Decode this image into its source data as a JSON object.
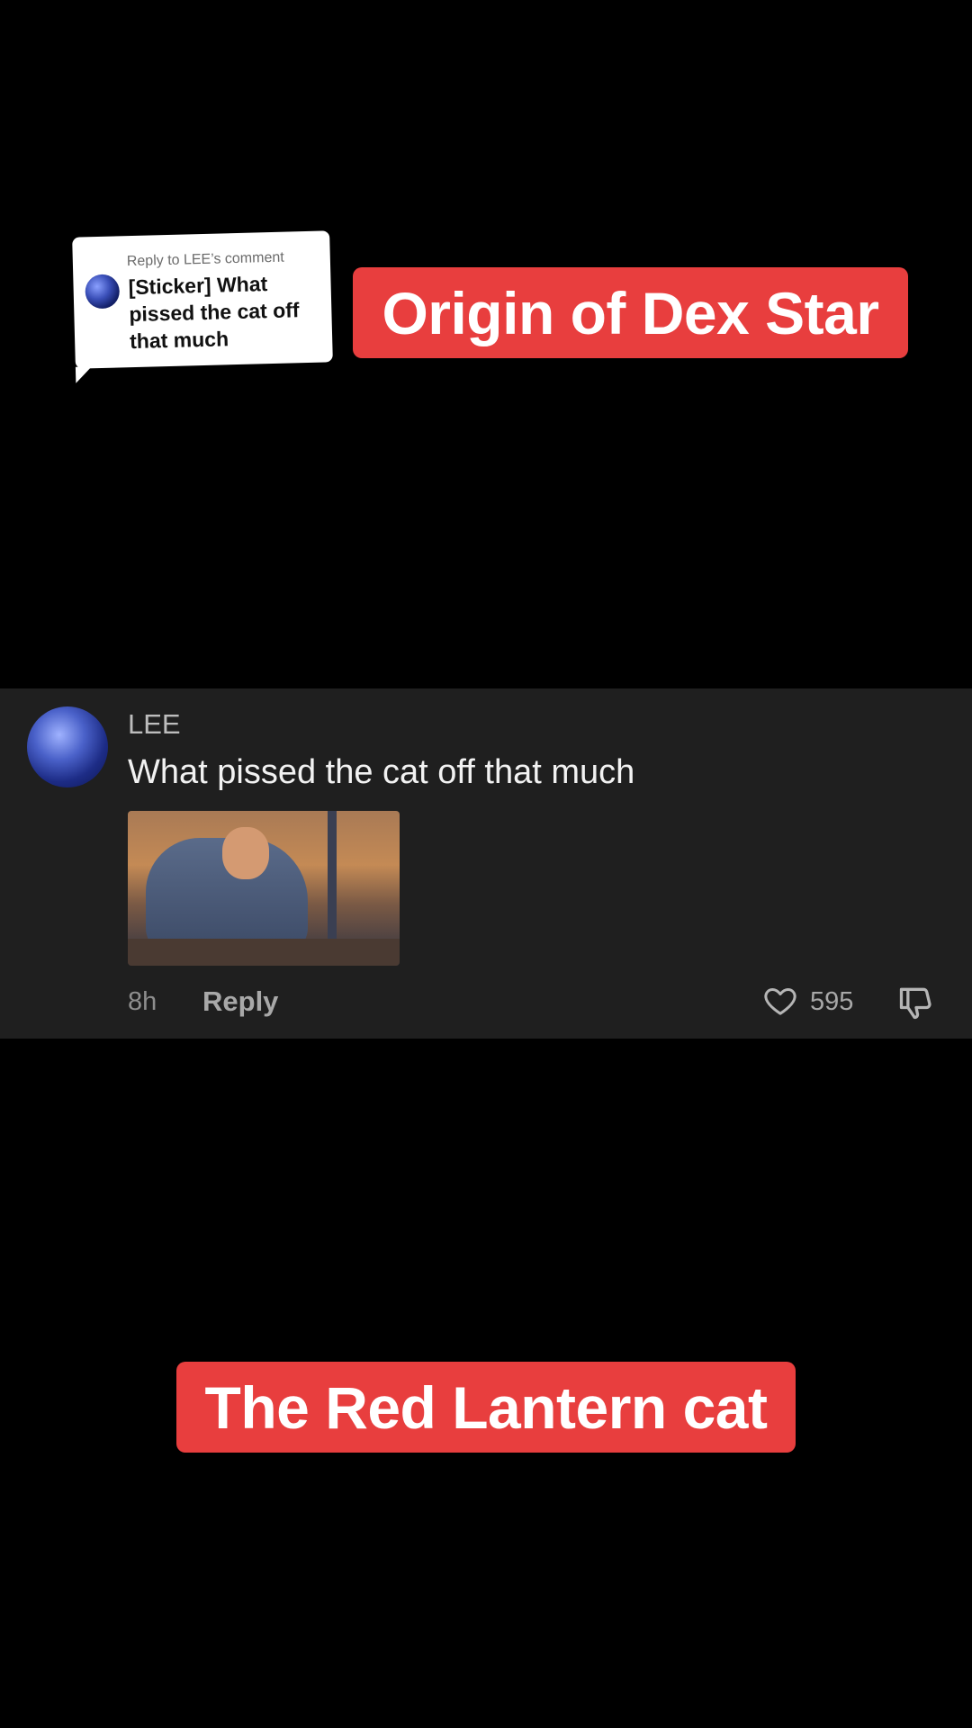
{
  "reply_sticker": {
    "reply_to": "Reply to LEE’s comment",
    "text": "[Sticker] What pissed the cat off that much"
  },
  "captions": {
    "top": "Origin of Dex Star",
    "bottom": "The Red Lantern cat"
  },
  "comment": {
    "username": "LEE",
    "text": "What pissed the cat off that much",
    "time": "8h",
    "reply_label": "Reply",
    "like_count": "595"
  },
  "colors": {
    "caption_bg": "#e83e3e",
    "panel_bg": "#1f1f1f",
    "background": "#000000"
  }
}
